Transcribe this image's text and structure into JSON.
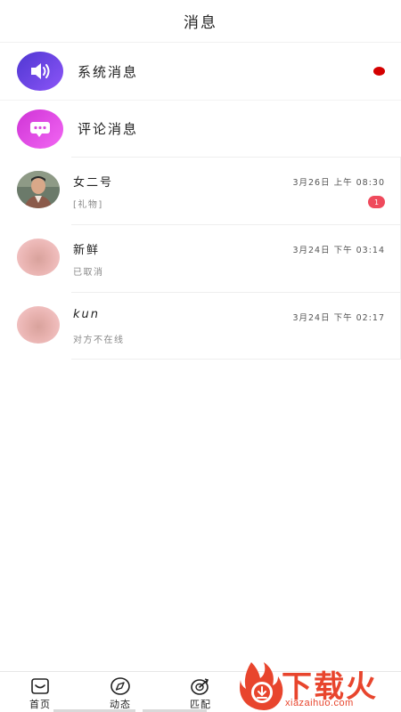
{
  "header": {
    "title": "消息"
  },
  "system_rows": [
    {
      "label": "系统消息",
      "icon": "speaker-icon",
      "gradient": [
        "#5f3bd6",
        "#8a52f5"
      ],
      "has_red_dot": true
    },
    {
      "label": "评论消息",
      "icon": "chat-bubble-icon",
      "gradient": [
        "#d43ad9",
        "#f060f0"
      ]
    }
  ],
  "chats": [
    {
      "name": "女二号",
      "time": "3月26日 上午 08:30",
      "preview": "[礼物]",
      "unread": "1",
      "avatar": "photo"
    },
    {
      "name": "新鲜",
      "time": "3月24日 下午 03:14",
      "preview": "已取消",
      "avatar": "blurred"
    },
    {
      "name": "kun",
      "time": "3月24日 下午 02:17",
      "preview": "对方不在线",
      "avatar": "blurred"
    }
  ],
  "tabbar": {
    "tabs": [
      {
        "label": "首页",
        "icon": "home-icon"
      },
      {
        "label": "动态",
        "icon": "compass-icon"
      },
      {
        "label": "匹配",
        "icon": "target-icon"
      }
    ]
  },
  "watermark": {
    "title": "下载火",
    "url": "xiazaihuo.com"
  },
  "colors": {
    "red_dot": "#d40000",
    "badge": "#ef4a5c",
    "watermark": "#e8452d"
  }
}
